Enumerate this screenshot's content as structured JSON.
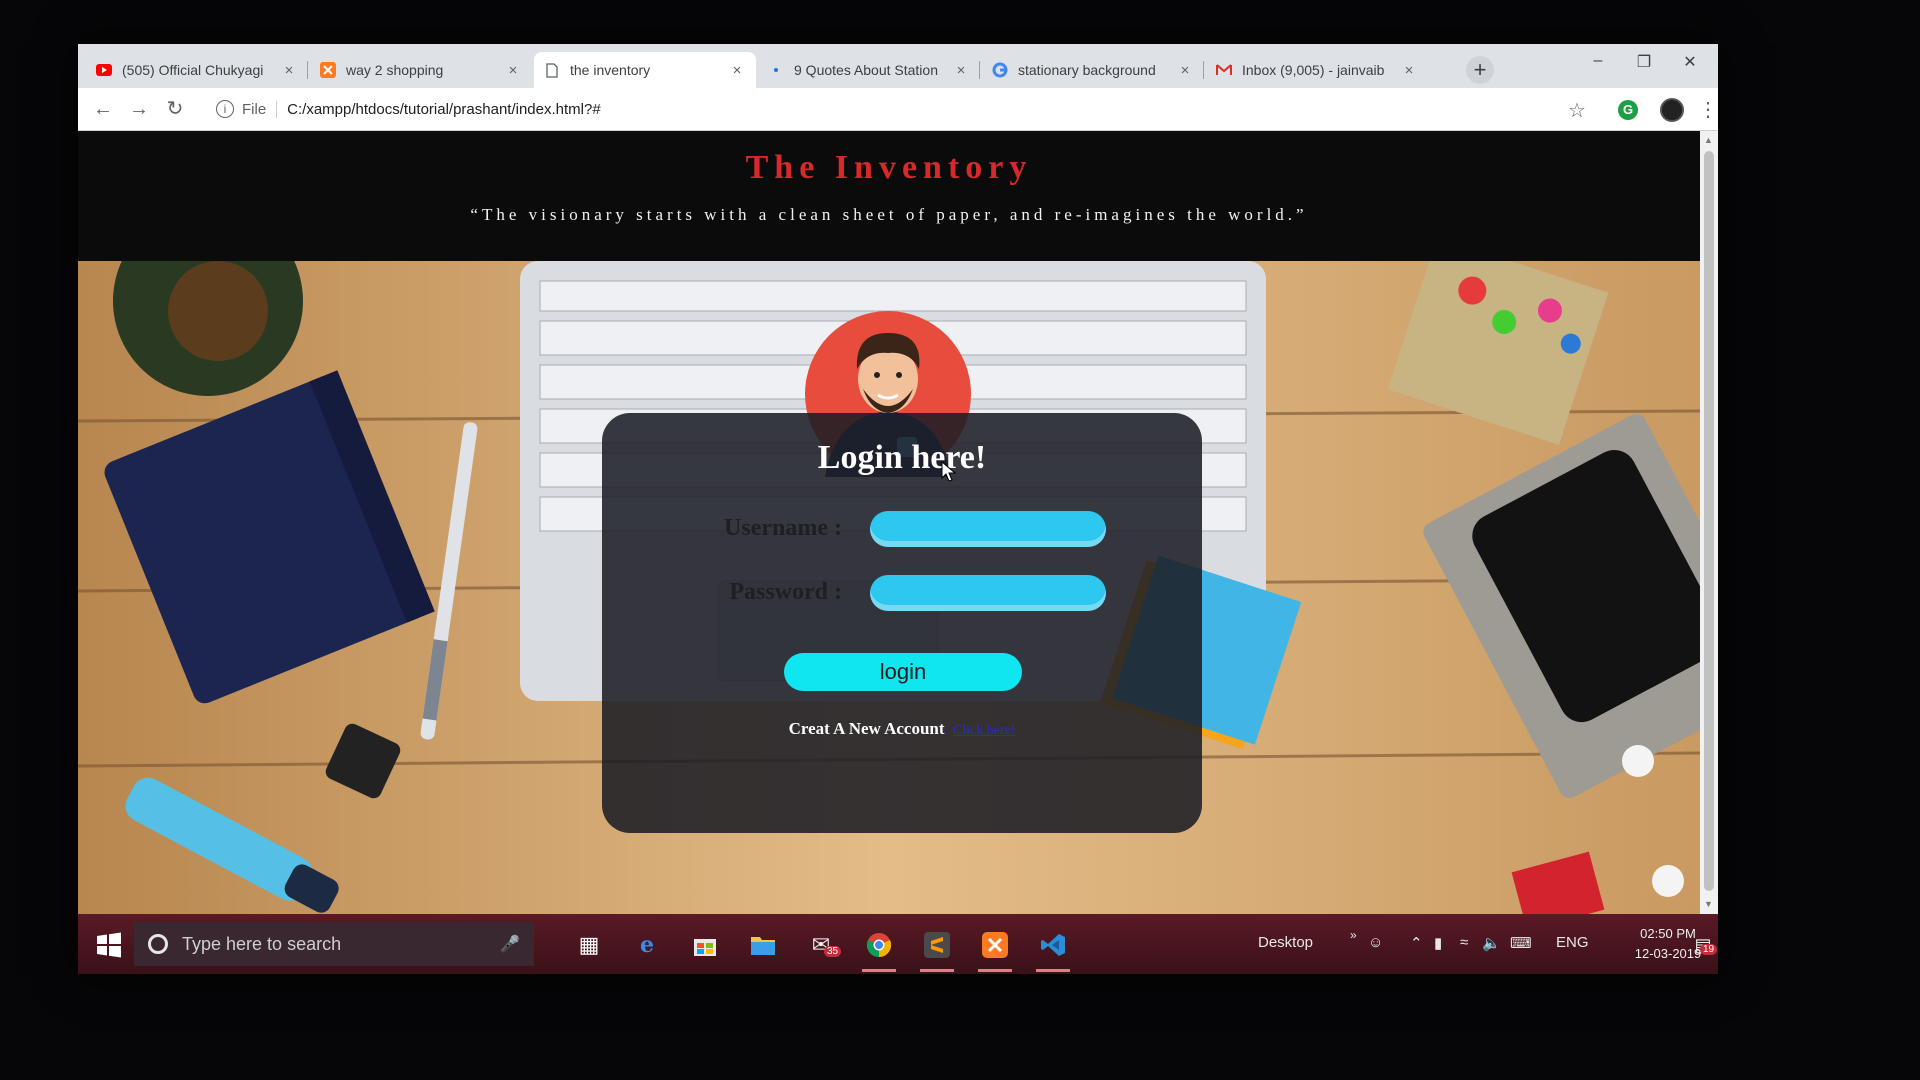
{
  "browser": {
    "tabs": [
      {
        "title": "(505) Official Chukyagi",
        "icon": "youtube-icon",
        "active": false
      },
      {
        "title": "way 2 shopping",
        "icon": "xampp-icon",
        "active": false
      },
      {
        "title": "the inventory",
        "icon": "page-icon",
        "active": true
      },
      {
        "title": "9 Quotes About Station",
        "icon": "loading-icon",
        "active": false
      },
      {
        "title": "stationary background",
        "icon": "google-icon",
        "active": false
      },
      {
        "title": "Inbox (9,005) - jainvaib",
        "icon": "gmail-icon",
        "active": false
      }
    ],
    "close_glyph": "×",
    "new_tab_glyph": "+",
    "address": {
      "scheme_label": "File",
      "url": "C:/xampp/htdocs/tutorial/prashant/index.html?#"
    }
  },
  "page": {
    "site_title": "The Inventory",
    "quote": "“The visionary starts with a clean sheet of paper, and re-imagines the world.”",
    "login": {
      "heading": "Login here!",
      "username_label": "Username :",
      "password_label": "Password :",
      "username_value": "",
      "password_value": "",
      "button_label": "login",
      "create_text": "Creat A New Account",
      "create_link": "Click here!"
    }
  },
  "taskbar": {
    "search_placeholder": "Type here to search",
    "mail_badge": "35",
    "desktop_label": "Desktop",
    "language": "ENG",
    "time": "02:50 PM",
    "date": "12-03-2019",
    "notification_count": "19"
  },
  "colors": {
    "title_red": "#d62a2a",
    "input_blue": "#2ec7ef",
    "button_cyan": "#10e6ef",
    "taskbar": "#4a1520"
  }
}
